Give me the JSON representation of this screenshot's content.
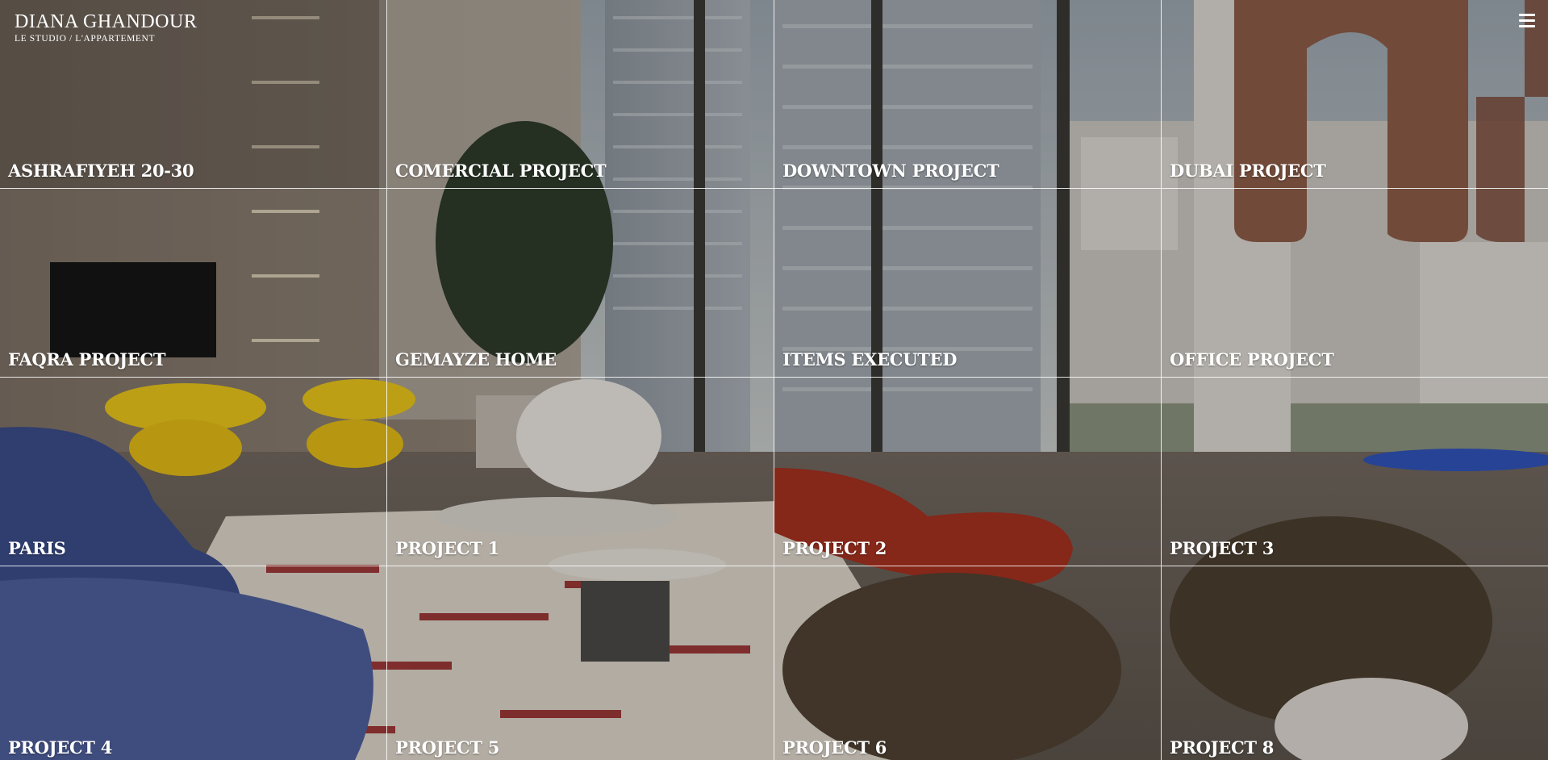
{
  "brand": {
    "name": "DIANA GHANDOUR",
    "tagline": "LE STUDIO / L'APPARTEMENT"
  },
  "menu": {
    "icon": "hamburger-menu-icon"
  },
  "projects": [
    {
      "label": "ASHRAFIYEH 20-30"
    },
    {
      "label": "COMERCIAL PROJECT"
    },
    {
      "label": "DOWNTOWN PROJECT"
    },
    {
      "label": "DUBAI PROJECT"
    },
    {
      "label": "FAQRA PROJECT"
    },
    {
      "label": "GEMAYZE HOME"
    },
    {
      "label": "ITEMS EXECUTED"
    },
    {
      "label": "OFFICE PROJECT"
    },
    {
      "label": "PARIS"
    },
    {
      "label": "PROJECT 1"
    },
    {
      "label": "PROJECT 2"
    },
    {
      "label": "PROJECT 3"
    },
    {
      "label": "PROJECT 4"
    },
    {
      "label": "PROJECT 5"
    },
    {
      "label": "PROJECT 6"
    },
    {
      "label": "PROJECT 8"
    }
  ],
  "colors": {
    "text": "#ffffff",
    "grid_lines": "#ffffff"
  }
}
